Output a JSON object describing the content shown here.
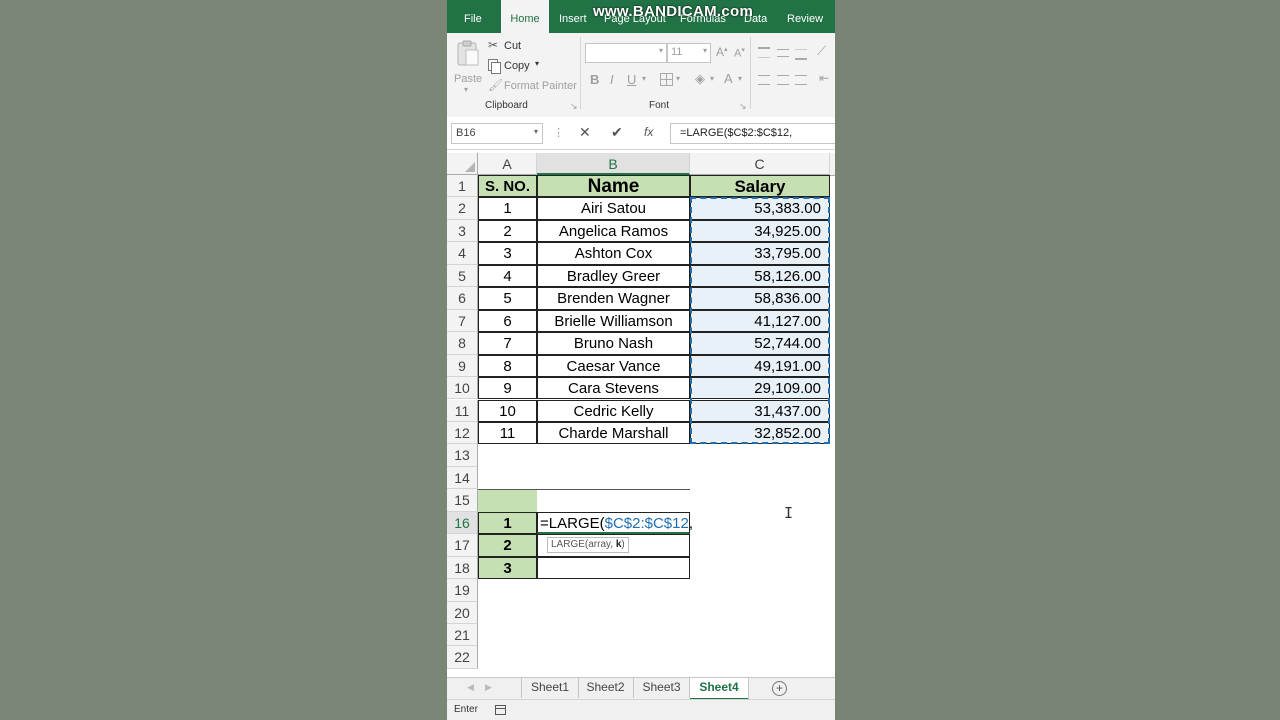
{
  "watermark": "www.BANDICAM.com",
  "ribbon_tabs": [
    {
      "label": "File"
    },
    {
      "label": "Home"
    },
    {
      "label": "Insert"
    },
    {
      "label": "Page Layout"
    },
    {
      "label": "Formulas"
    },
    {
      "label": "Data"
    },
    {
      "label": "Review"
    }
  ],
  "clipboard": {
    "paste_label": "Paste",
    "cut_label": "Cut",
    "copy_label": "Copy",
    "format_painter_label": "Format Painter",
    "group_label": "Clipboard"
  },
  "font": {
    "font_name": "",
    "font_size": "11",
    "bold": "B",
    "italic": "I",
    "underline": "U",
    "group_label": "Font"
  },
  "formula_bar": {
    "name_box": "B16",
    "fx": "fx",
    "formula": "=LARGE($C$2:$C$12,"
  },
  "columns": [
    "A",
    "B",
    "C"
  ],
  "rows": [
    "1",
    "2",
    "3",
    "4",
    "5",
    "6",
    "7",
    "8",
    "9",
    "10",
    "11",
    "12",
    "13",
    "14",
    "15",
    "16",
    "17",
    "18",
    "19",
    "20",
    "21",
    "22"
  ],
  "headers": {
    "a": "S. NO.",
    "b": "Name",
    "c": "Salary"
  },
  "table": [
    {
      "sno": "1",
      "name": "Airi Satou",
      "salary": "53,383.00"
    },
    {
      "sno": "2",
      "name": "Angelica Ramos",
      "salary": "34,925.00"
    },
    {
      "sno": "3",
      "name": "Ashton Cox",
      "salary": "33,795.00"
    },
    {
      "sno": "4",
      "name": "Bradley Greer",
      "salary": "58,126.00"
    },
    {
      "sno": "5",
      "name": "Brenden Wagner",
      "salary": "58,836.00"
    },
    {
      "sno": "6",
      "name": "Brielle Williamson",
      "salary": "41,127.00"
    },
    {
      "sno": "7",
      "name": "Bruno Nash",
      "salary": "52,744.00"
    },
    {
      "sno": "8",
      "name": "Caesar Vance",
      "salary": "49,191.00"
    },
    {
      "sno": "9",
      "name": "Cara Stevens",
      "salary": "29,109.00"
    },
    {
      "sno": "10",
      "name": "Cedric Kelly",
      "salary": "31,437.00"
    },
    {
      "sno": "11",
      "name": "Charde Marshall",
      "salary": "32,852.00"
    }
  ],
  "rank_rows": [
    "1",
    "2",
    "3"
  ],
  "editing_cell": {
    "prefix": "=LARGE(",
    "ref": "$C$2:$C$12",
    "suffix": ","
  },
  "tooltip": {
    "fn": "LARGE(array, ",
    "arg": "k",
    "close": ")"
  },
  "sheets": [
    "Sheet1",
    "Sheet2",
    "Sheet3",
    "Sheet4"
  ],
  "active_sheet": "Sheet4",
  "status_mode": "Enter",
  "colors": {
    "excel_green": "#217346",
    "header_fill": "#c6e0b4",
    "selection_fill": "#e8f0f8",
    "reference_blue": "#1f6fb2"
  }
}
